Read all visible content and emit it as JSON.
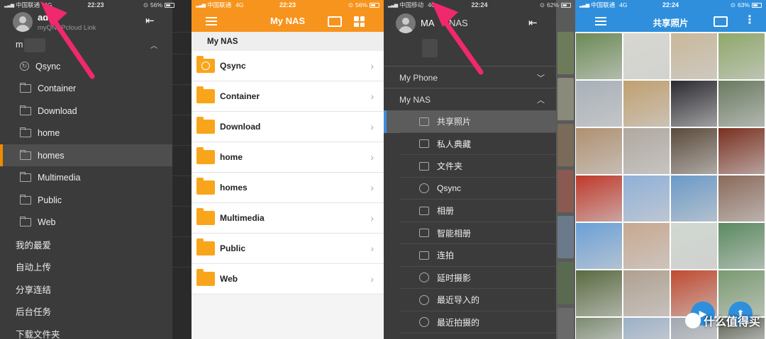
{
  "panel1": {
    "status": {
      "carrier": "中国联通",
      "network": "4G",
      "time": "22:23",
      "battery": "56%",
      "battery_level": 0.56
    },
    "user": {
      "name": "ad",
      "subtitle": "myQNAPcloud Link"
    },
    "group_title": "m",
    "items": [
      {
        "label": "Qsync",
        "icon": "qsync-icon",
        "type": "sub"
      },
      {
        "label": "Container",
        "icon": "folder-icon",
        "type": "sub"
      },
      {
        "label": "Download",
        "icon": "folder-icon",
        "type": "sub"
      },
      {
        "label": "home",
        "icon": "folder-icon",
        "type": "sub"
      },
      {
        "label": "homes",
        "icon": "folder-icon",
        "type": "sub",
        "selected": true
      },
      {
        "label": "Multimedia",
        "icon": "folder-icon",
        "type": "sub"
      },
      {
        "label": "Public",
        "icon": "folder-icon",
        "type": "sub"
      },
      {
        "label": "Web",
        "icon": "folder-icon",
        "type": "sub"
      },
      {
        "label": "我的最爱",
        "type": "top"
      },
      {
        "label": "自动上传",
        "type": "top"
      },
      {
        "label": "分享连结",
        "type": "top"
      },
      {
        "label": "后台任务",
        "type": "top"
      },
      {
        "label": "下载文件夹",
        "type": "top"
      }
    ]
  },
  "panel2": {
    "status": {
      "carrier": "中国联通",
      "network": "4G",
      "time": "22:23",
      "battery": "56%",
      "battery_level": 0.56
    },
    "title": "My NAS",
    "section": "My NAS",
    "folders": [
      "Qsync",
      "Container",
      "Download",
      "home",
      "homes",
      "Multimedia",
      "Public",
      "Web"
    ],
    "accent": "#f7941d"
  },
  "panel3": {
    "status": {
      "carrier": "中国移动",
      "network": "4G",
      "time": "22:24",
      "battery": "62%",
      "battery_level": 0.62
    },
    "user": {
      "name": "MA",
      "server": "NAS"
    },
    "groups": [
      {
        "label": "My Phone",
        "caret": "expand"
      },
      {
        "label": "My NAS",
        "caret": "collapse"
      }
    ],
    "items": [
      {
        "label": "共享照片",
        "icon": "photo-icon",
        "active": true
      },
      {
        "label": "私人典藏",
        "icon": "lock-icon"
      },
      {
        "label": "文件夹",
        "icon": "folder-icon"
      },
      {
        "label": "Qsync",
        "icon": "qsync-icon"
      },
      {
        "label": "相册",
        "icon": "album-icon"
      },
      {
        "label": "智能相册",
        "icon": "smart-album-icon"
      },
      {
        "label": "连拍",
        "icon": "burst-icon"
      },
      {
        "label": "延时摄影",
        "icon": "timelapse-icon"
      },
      {
        "label": "最近导入的",
        "icon": "recent-import-icon"
      },
      {
        "label": "最近拍摄的",
        "icon": "recent-taken-icon"
      }
    ],
    "accent": "#3c8dde"
  },
  "panel4": {
    "status": {
      "carrier": "中国联通",
      "network": "4G",
      "time": "22:24",
      "battery": "63%",
      "battery_level": 0.63
    },
    "title": "共享照片",
    "accent": "#2f8fdc",
    "watermark": "什么值得买"
  }
}
